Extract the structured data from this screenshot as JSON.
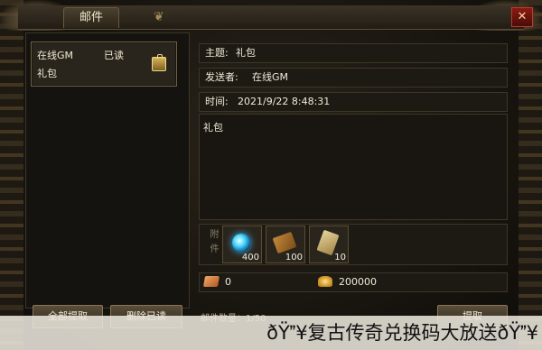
{
  "window": {
    "title": "邮件",
    "close_icon": "close-icon"
  },
  "mail_list": {
    "items": [
      {
        "sender": "在线GM",
        "status": "已读",
        "subject": "礼包",
        "icon": "gift-icon"
      }
    ]
  },
  "mail_detail": {
    "subject_label": "主题:",
    "subject_value": "礼包",
    "sender_label": "发送者:",
    "sender_value": "在线GM",
    "time_label": "时间:",
    "time_value": "2021/9/22 8:48:31",
    "body": "礼包",
    "attachment_label": "附件",
    "attachments": [
      {
        "icon": "blue-orb-icon",
        "quantity": "400"
      },
      {
        "icon": "scroll-icon",
        "quantity": "100"
      },
      {
        "icon": "paper-scroll-icon",
        "quantity": "10"
      }
    ],
    "currency": {
      "copper": "0",
      "gold": "200000"
    }
  },
  "buttons": {
    "collect_all": "全部提取",
    "delete_read": "删除已读",
    "collect": "提取"
  },
  "mail_count": "邮件数量：1/50",
  "banner": "ðŸ¥复古传奇兑换码大放送ðŸ¥"
}
